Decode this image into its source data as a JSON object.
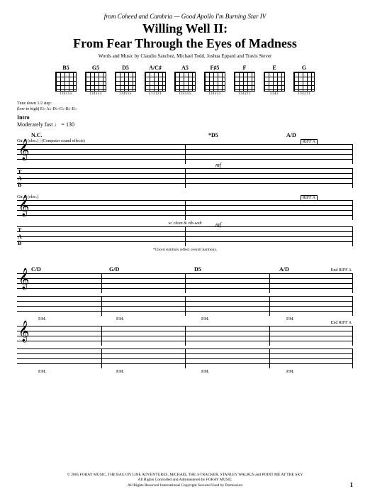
{
  "header": {
    "from_line": "from Coheed and Cambria — Good Apollo I'm Burning Star IV",
    "title_line1": "Willing Well II:",
    "title_line2": "From Fear Through the Eyes of Madness",
    "credits": "Words and Music by Claudio Sanchez, Michael Todd, Joshua Eppard and Travis Stever"
  },
  "chords": [
    {
      "name": "B5",
      "fing": "134xxx"
    },
    {
      "name": "G5",
      "fing": "134xxx"
    },
    {
      "name": "D5",
      "fing": "134xxx"
    },
    {
      "name": "A/C♯",
      "fing": "x13121"
    },
    {
      "name": "A5",
      "fing": "134xxx"
    },
    {
      "name": "F♯5",
      "fing": "134xxx"
    },
    {
      "name": "F",
      "fing": "134211"
    },
    {
      "name": "E",
      "fing": "x342"
    },
    {
      "name": "G",
      "fing": "134211"
    }
  ],
  "tuning": {
    "line1": "Tune down 1/2 step:",
    "line2": "(low to high) E♭-A♭-D♭-G♭-B♭-E♭"
  },
  "intro": {
    "label": "Intro",
    "tempo": "Moderately fast ♩ = 130"
  },
  "system1": {
    "marks": {
      "nc": "N.C.",
      "d5": "*D5",
      "ad": "A/D"
    },
    "gtr1": "Gtr. 1 (elec.) | (Computer sound effects)",
    "gtr2": "Gtr. 2 (elec.)",
    "rhyfilla": "RIFF A",
    "dyn": "mf",
    "gtr2_note": "w/ clean & vib-wah",
    "footnote": "*Chord symbols reflect overall harmony."
  },
  "system2": {
    "marks": {
      "cd": "C/D",
      "gd": "G/D",
      "d5": "D5",
      "ad": "A/D"
    },
    "endriff": "End RIFF A",
    "pm": "P.M."
  },
  "footer": {
    "line1": "© 2005 FORAY MUSIC, THE BAG ON LINE ADVENTURES, MICHAEL THE 4-TRACKER, STANLEY WALRUS and POINT ME AT THE SKY",
    "line2": "All Rights Controlled and Administered by FORAY MUSIC",
    "line3": "All Rights Reserved   International Copyright Secured   Used by Permission",
    "page": "1"
  }
}
